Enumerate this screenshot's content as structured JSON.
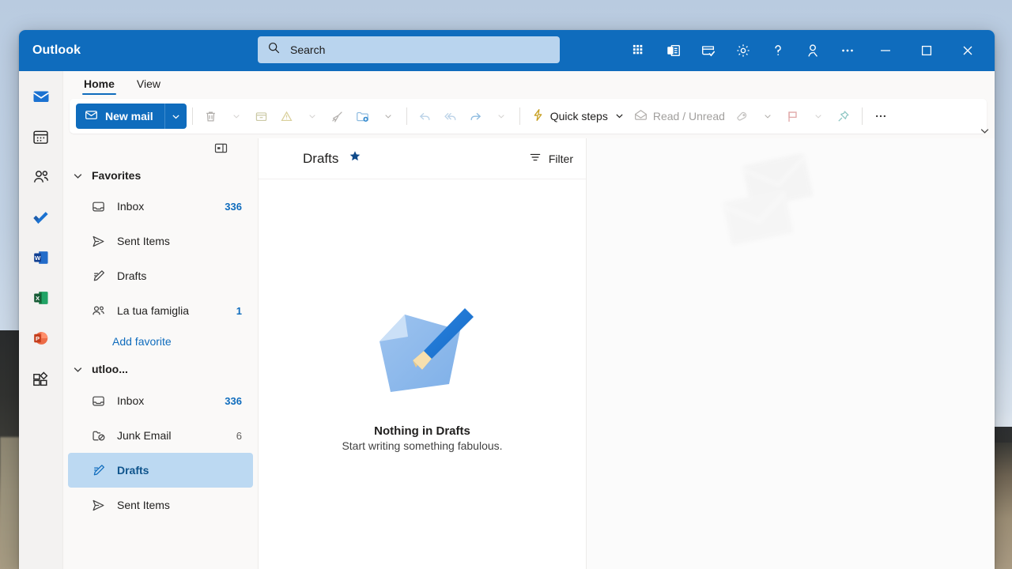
{
  "window": {
    "brand": "Outlook",
    "search_placeholder": "Search",
    "titlebar_icons": [
      {
        "name": "apps-grid-icon",
        "label": "Microsoft apps"
      },
      {
        "name": "outlook-switch-icon",
        "label": "Switch to classic Outlook"
      },
      {
        "name": "todo-tasks-icon",
        "label": "My Day"
      },
      {
        "name": "gear-icon",
        "label": "Settings"
      },
      {
        "name": "help-icon",
        "label": "Help"
      },
      {
        "name": "account-icon",
        "label": "Account manager"
      },
      {
        "name": "more-options-icon",
        "label": "More options"
      }
    ],
    "controls": [
      {
        "name": "minimize-button",
        "label": "Minimize"
      },
      {
        "name": "maximize-button",
        "label": "Maximize"
      },
      {
        "name": "close-button",
        "label": "Close"
      }
    ],
    "accent_color": "#0f6cbd",
    "search_bg": "#b9d4ee"
  },
  "rail": {
    "items": [
      {
        "name": "rail-mail",
        "label": "Mail",
        "active": true
      },
      {
        "name": "rail-calendar",
        "label": "Calendar",
        "active": false
      },
      {
        "name": "rail-people",
        "label": "People",
        "active": false
      },
      {
        "name": "rail-todo",
        "label": "To Do",
        "active": false
      },
      {
        "name": "rail-word",
        "label": "Word",
        "active": false
      },
      {
        "name": "rail-excel",
        "label": "Excel",
        "active": false
      },
      {
        "name": "rail-powerpoint",
        "label": "PowerPoint",
        "active": false
      },
      {
        "name": "rail-more-apps",
        "label": "More apps",
        "active": false
      }
    ]
  },
  "ribbon": {
    "tabs": [
      {
        "label": "Home",
        "active": true
      },
      {
        "label": "View",
        "active": false
      }
    ],
    "new_mail_label": "New mail",
    "quick_steps_label": "Quick steps",
    "read_unread_label": "Read / Unread",
    "buttons": [
      {
        "name": "delete-button",
        "label": "Delete",
        "enabled": false
      },
      {
        "name": "archive-button",
        "label": "Archive",
        "enabled": false
      },
      {
        "name": "report-junk-button",
        "label": "Report",
        "enabled": false
      },
      {
        "name": "sweep-button",
        "label": "Sweep",
        "enabled": false
      },
      {
        "name": "move-to-button",
        "label": "Move to",
        "enabled": false
      },
      {
        "name": "reply-button",
        "label": "Reply",
        "enabled": false
      },
      {
        "name": "reply-all-button",
        "label": "Reply all",
        "enabled": false
      },
      {
        "name": "forward-button",
        "label": "Forward",
        "enabled": false
      },
      {
        "name": "tag-button",
        "label": "Tag",
        "enabled": false
      },
      {
        "name": "flag-button",
        "label": "Flag",
        "enabled": false
      },
      {
        "name": "pin-button",
        "label": "Pin",
        "enabled": false
      },
      {
        "name": "ribbon-overflow-button",
        "label": "More commands",
        "enabled": true
      }
    ]
  },
  "folders": {
    "favorites": {
      "label": "Favorites",
      "expanded": true,
      "items": [
        {
          "name": "favorite-inbox",
          "icon": "inbox-icon",
          "label": "Inbox",
          "count": "336",
          "count_style": "blue",
          "selected": false
        },
        {
          "name": "favorite-sent-items",
          "icon": "send-icon",
          "label": "Sent Items",
          "count": "",
          "count_style": "none",
          "selected": false
        },
        {
          "name": "favorite-drafts",
          "icon": "drafts-pencil-icon",
          "label": "Drafts",
          "count": "",
          "count_style": "none",
          "selected": false
        },
        {
          "name": "favorite-la-tua-famiglia",
          "icon": "people-icon",
          "label": "La tua famiglia",
          "count": "1",
          "count_style": "blue",
          "selected": false
        }
      ],
      "add_favorite_label": "Add favorite"
    },
    "account": {
      "name": "account-node",
      "label": "utloo...",
      "expanded": true,
      "items": [
        {
          "name": "folder-inbox",
          "icon": "inbox-icon",
          "label": "Inbox",
          "count": "336",
          "count_style": "blue",
          "selected": false
        },
        {
          "name": "folder-junk-email",
          "icon": "junk-icon",
          "label": "Junk Email",
          "count": "6",
          "count_style": "grey",
          "selected": false
        },
        {
          "name": "folder-drafts",
          "icon": "drafts-pencil-icon",
          "label": "Drafts",
          "count": "",
          "count_style": "none",
          "selected": true
        },
        {
          "name": "folder-sent-items",
          "icon": "send-icon",
          "label": "Sent Items",
          "count": "",
          "count_style": "none",
          "selected": false
        }
      ]
    },
    "collapse_icon": "collapse-pane-icon"
  },
  "message_list": {
    "title": "Drafts",
    "pinned_icon": "favorite-star-icon",
    "filter_label": "Filter",
    "empty_title": "Nothing in Drafts",
    "empty_subtitle": "Start writing something fabulous."
  },
  "reading_pane": {
    "watermark_icon": "envelopes-watermark-icon"
  }
}
